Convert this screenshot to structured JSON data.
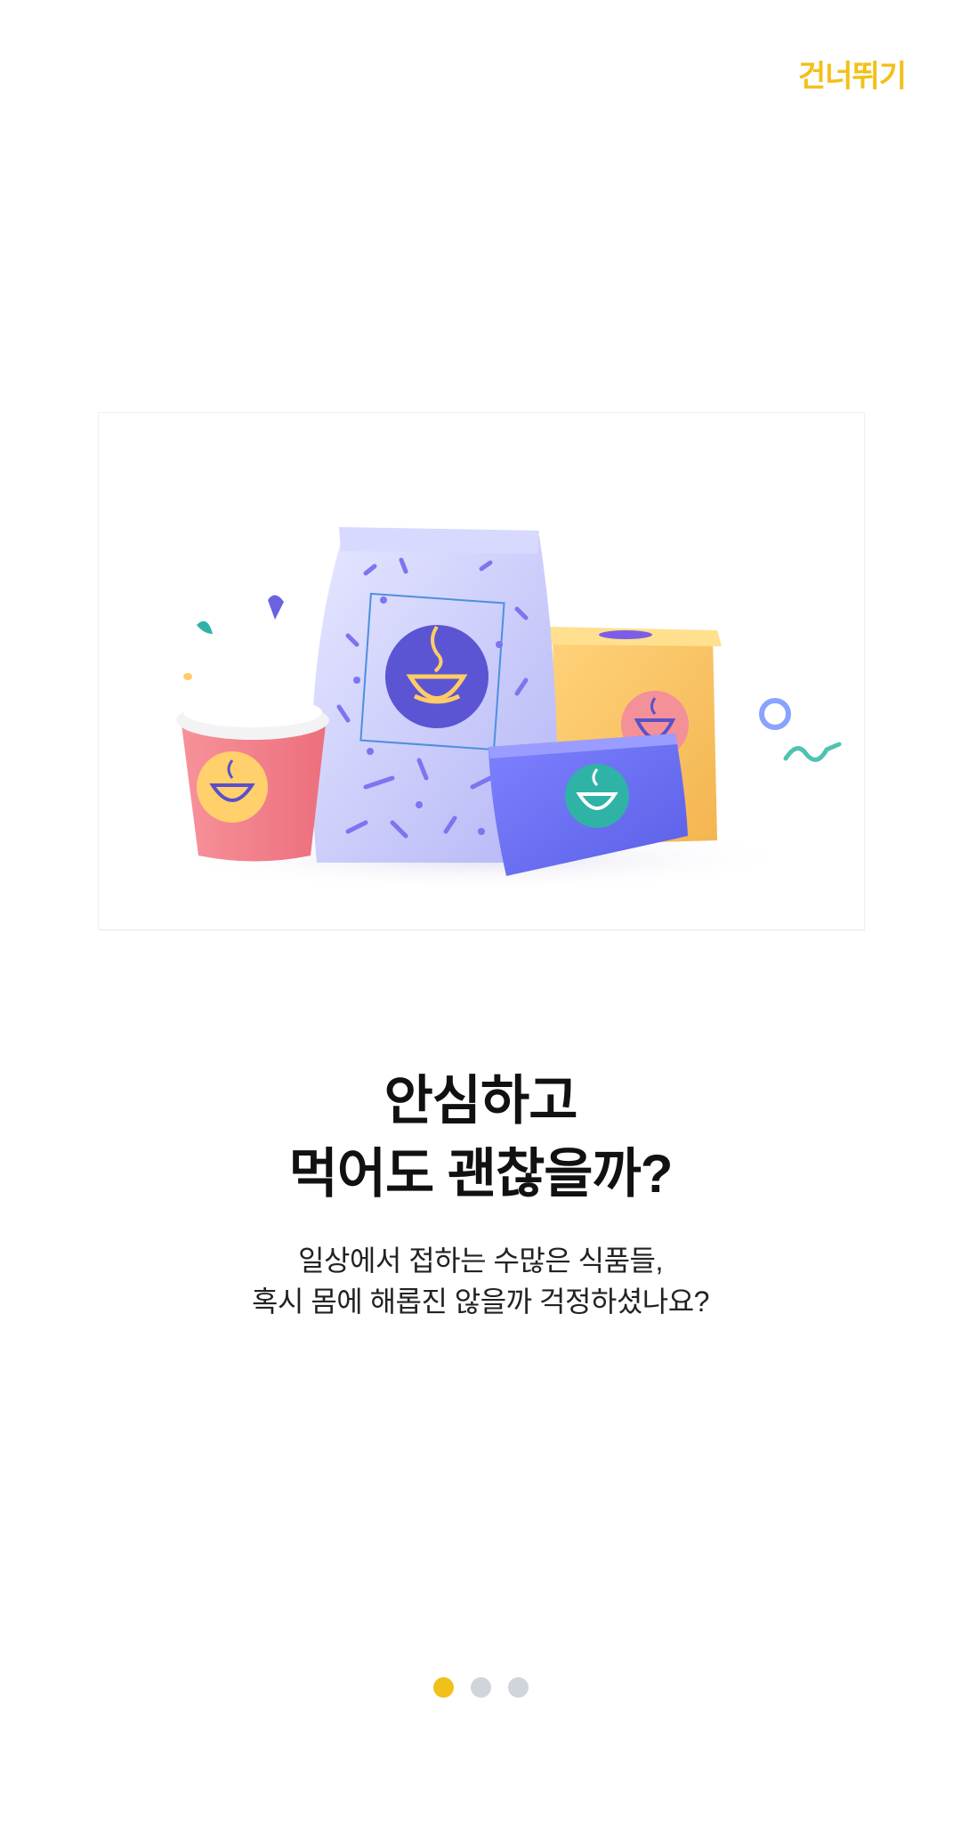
{
  "header": {
    "skip_label": "건너뛰기",
    "accent_color": "#F2C01A"
  },
  "hero": {
    "image_semantic": "coffee-products-illustration"
  },
  "content": {
    "title_line1": "안심하고",
    "title_line2": "먹어도 괜찮을까?",
    "desc_line1": "일상에서 접하는 수많은 식품들,",
    "desc_line2": "혹시 몸에 해롭진 않을까 걱정하셨나요?"
  },
  "pager": {
    "total_pages": 3,
    "current_page": 1,
    "active_color": "#F2C01A",
    "inactive_color": "#D0D4DB"
  }
}
